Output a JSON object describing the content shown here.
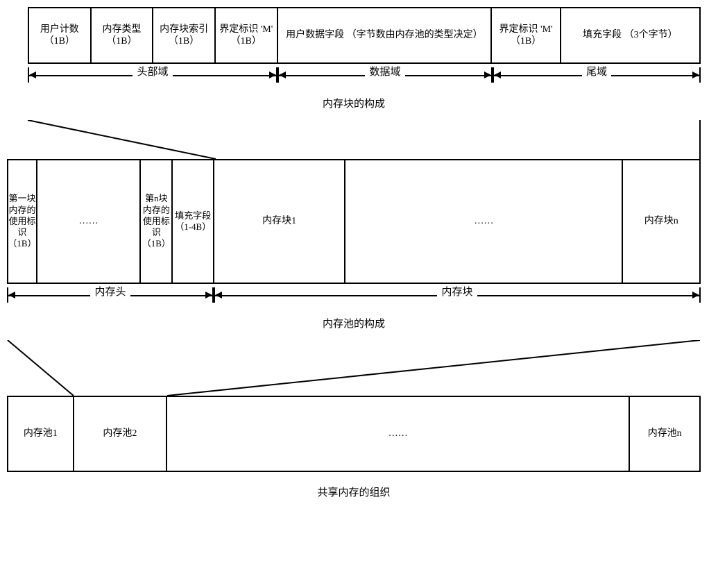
{
  "block": {
    "cells": [
      "用户计数\n（1B）",
      "内存类型\n（1B）",
      "内存块索引\n（1B）",
      "界定标识\n'M'\n（1B）",
      "用户数据字段\n（字节数由内存池的类型决定）",
      "界定标识\n'M'\n（1B）",
      "填充字段\n（3个字节）"
    ],
    "regions": [
      "头部域",
      "数据域",
      "尾域"
    ],
    "caption": "内存块的构成"
  },
  "pool": {
    "cells": [
      "第一块内存的使用标识（1B）",
      "……",
      "第n块内存的使用标识（1B）",
      "填充字段（1-4B）",
      "内存块1",
      "……",
      "内存块n"
    ],
    "regions": [
      "内存头",
      "内存块"
    ],
    "caption": "内存池的构成"
  },
  "shm": {
    "cells": [
      "内存池1",
      "内存池2",
      "……",
      "内存池n"
    ],
    "caption": "共享内存的组织"
  }
}
